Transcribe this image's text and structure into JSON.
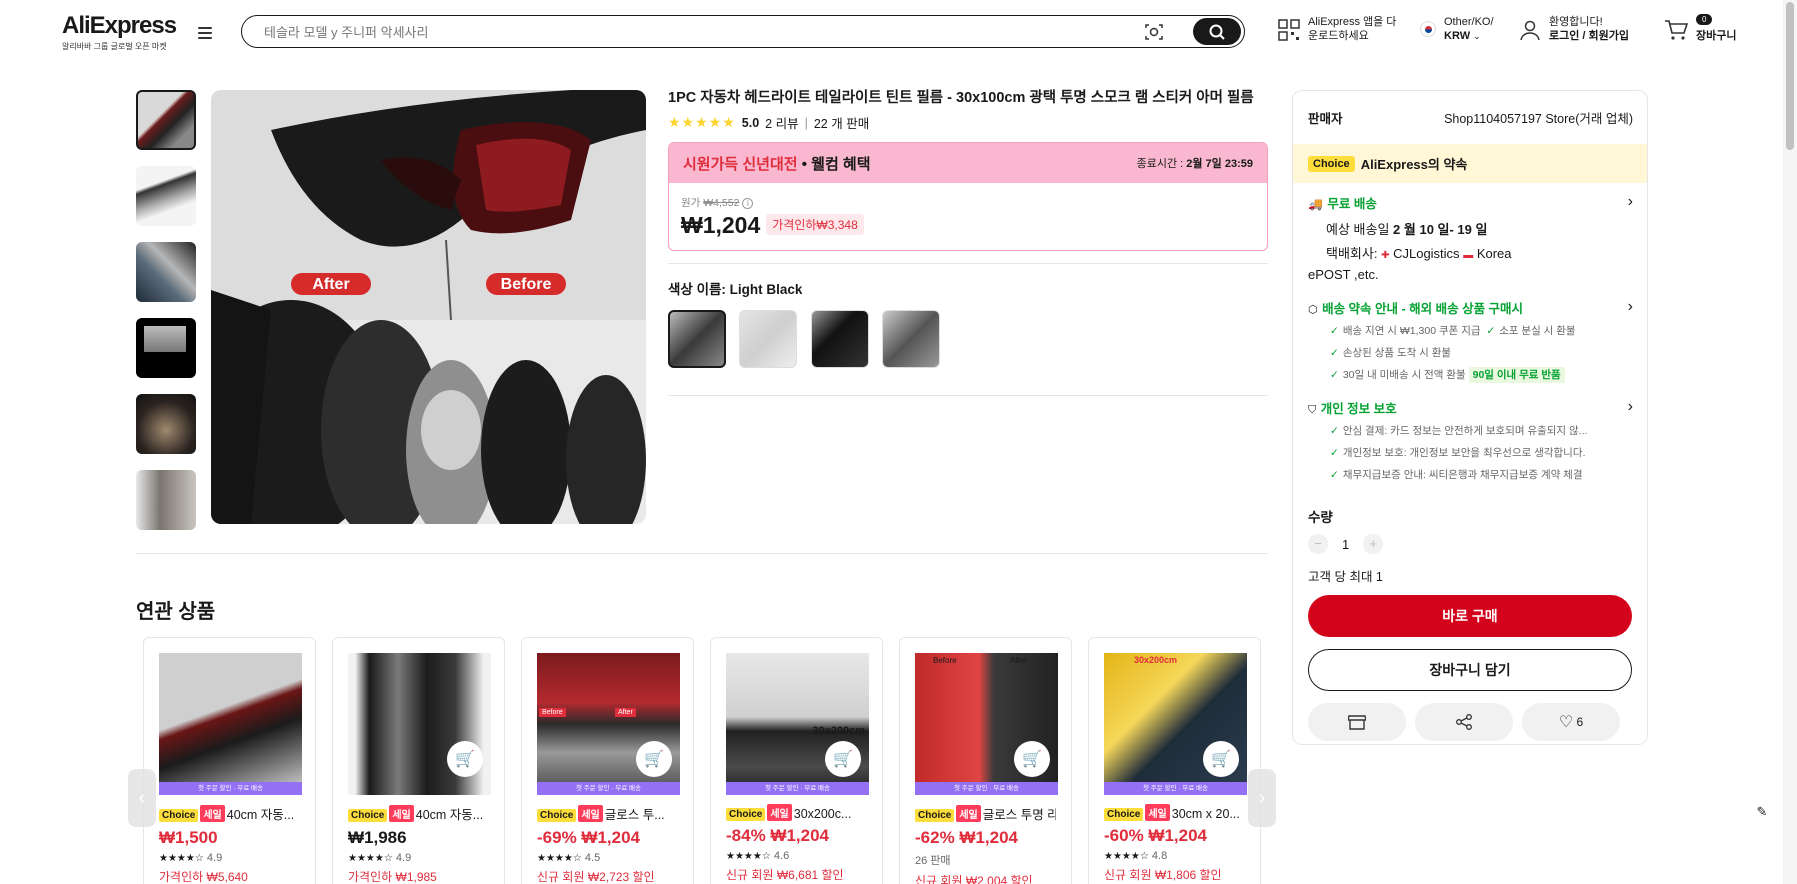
{
  "header": {
    "logo": "AliExpress",
    "tagline": "알리바바 그룹 글로벌 오픈 마켓",
    "search_placeholder": "테슬라 모델 y 주니퍼 악세사리",
    "app_line1": "AliExpress 앱을 다",
    "app_line2": "운로드하세요",
    "locale_line1": "Other/KO/",
    "locale_line2": "KRW",
    "welcome": "환영합니다!",
    "login": "로그인 / 회원가입",
    "cart_count": "0",
    "cart_label": "장바구니"
  },
  "product": {
    "title": "1PC 자동차 헤드라이트 테일라이트 틴트 필름 - 30x100cm 광택 투명 스모크 램 스티커 아머 필름",
    "rating": "5.0",
    "reviews": "2 리뷰",
    "sold": "22 개 판매",
    "image_label_after": "After",
    "image_label_before": "Before",
    "promo_title": "시원가득 신년대전",
    "promo_sub": "• 웰컴 혜택",
    "promo_end_label": "종료시간 :",
    "promo_end_time": "2월 7일 23:59",
    "orig_label": "원가",
    "orig_price": "₩4,552",
    "price": "₩1,204",
    "discount": "가격인하₩3,348",
    "color_label": "색상 이름: Light Black"
  },
  "seller": {
    "label": "판매자",
    "name": "Shop1104057197 Store(거래 업체)",
    "promise_choice": "Choice",
    "promise_title": "AliExpress의 약속",
    "free_ship": "무료 배송",
    "eta_prefix": "예상 배송일",
    "eta": "2 월 10 일- 19 일",
    "carrier_label": "택배회사:",
    "carrier1": "CJLogistics",
    "carrier2": "Korea",
    "carrier3": "ePOST ,etc.",
    "promise_link": "배송 약속 안내 - 해외 배송 상품 구매시",
    "promise_items": [
      "배송 지연 시 ₩1,300 쿠폰 지급",
      "소포 분실 시 환불",
      "손상된 상품 도착 시 환불",
      "30일 내 미배송 시 전액 환불"
    ],
    "return_badge": "90일 이내 무료 반품",
    "privacy_title": "개인 정보 보호",
    "privacy_items": [
      "안심 결제: 카드 정보는 안전하게 보호되며 유출되지 않...",
      "개인정보 보호: 개인정보 보안을 최우선으로 생각합니다.",
      "채무지급보증 안내: 씨티은행과 채무지급보증 계약 체결"
    ],
    "qty_label": "수량",
    "qty_minus": "−",
    "qty_value": "1",
    "qty_plus": "+",
    "qty_limit": "고객 당 최대 1",
    "buy_now": "바로 구매",
    "add_cart": "장바구니 담기",
    "wish_count": "6"
  },
  "related": {
    "title": "연관 상품",
    "bar_text": "첫 주문 할인 · 무료 배송",
    "items": [
      {
        "choice": "Choice",
        "sale": "세일",
        "title": "40cm 자동...",
        "price": "₩1,500",
        "stars": "★★★★☆",
        "rating": "4.9",
        "promo": "가격인하 ₩5,640"
      },
      {
        "choice": "Choice",
        "sale": "세일",
        "title": "40cm 자동...",
        "price": "₩1,986",
        "stars": "★★★★☆",
        "rating": "4.9",
        "promo": "가격인하 ₩1,985"
      },
      {
        "choice": "Choice",
        "sale": "세일",
        "title": "글로스 투...",
        "price": "-69% ₩1,204",
        "stars": "★★★★☆",
        "rating": "4.5",
        "promo": "신규 회원 ₩2,723 할인"
      },
      {
        "choice": "Choice",
        "sale": "세일",
        "title": "30x200c...",
        "price": "-84% ₩1,204",
        "stars": "★★★★☆",
        "rating": "4.6",
        "promo": "신규 회원 ₩6,681 할인"
      },
      {
        "choice": "Choice",
        "sale": "세일",
        "title": "글로스 투명 라...",
        "price": "-62% ₩1,204",
        "stars": "",
        "rating": "26 판매",
        "promo": "신규 회원 ₩2,004 할인"
      },
      {
        "choice": "Choice",
        "sale": "세일",
        "title": "30cm x 20...",
        "price": "-60% ₩1,204",
        "stars": "★★★★☆",
        "rating": "4.8",
        "promo": "신규 회원 ₩1,806 할인"
      }
    ],
    "overlay_30x200": "30x200cm",
    "overlay_before": "Before",
    "overlay_after": "After"
  }
}
